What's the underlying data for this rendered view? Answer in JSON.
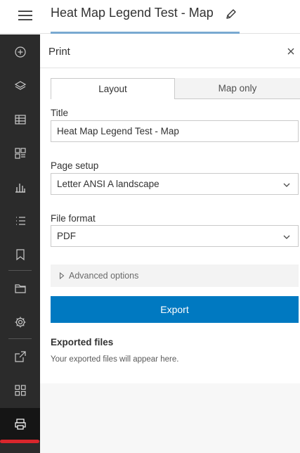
{
  "header": {
    "title": "Heat Map Legend Test - Map",
    "menu_icon": "hamburger-menu-icon",
    "edit_icon": "pencil-icon"
  },
  "rail": {
    "items": [
      {
        "icon": "add-circle-icon"
      },
      {
        "icon": "layers-icon"
      },
      {
        "icon": "table-icon"
      },
      {
        "icon": "legend-grid-icon"
      },
      {
        "icon": "bar-chart-icon"
      },
      {
        "icon": "list-icon"
      },
      {
        "icon": "bookmark-icon"
      },
      {
        "icon": "folder-icon"
      },
      {
        "icon": "settings-gear-icon"
      },
      {
        "icon": "share-export-icon"
      },
      {
        "icon": "apps-grid-icon"
      },
      {
        "icon": "print-icon",
        "active": true
      }
    ],
    "active_color": "#d8262c"
  },
  "panel": {
    "title": "Print",
    "close_icon": "close-icon",
    "tabs": [
      {
        "label": "Layout",
        "selected": true
      },
      {
        "label": "Map only",
        "selected": false
      }
    ],
    "title_field": {
      "label": "Title",
      "value": "Heat Map Legend Test - Map"
    },
    "page_setup": {
      "label": "Page setup",
      "value": "Letter ANSI A landscape"
    },
    "file_format": {
      "label": "File format",
      "value": "PDF"
    },
    "advanced_label": "Advanced options",
    "export_label": "Export",
    "exported_files_title": "Exported files",
    "exported_files_text": "Your exported files will appear here."
  },
  "colors": {
    "accent": "#0079c1",
    "rail_bg": "#2b2b2b",
    "title_underline": "#79a9d1"
  }
}
